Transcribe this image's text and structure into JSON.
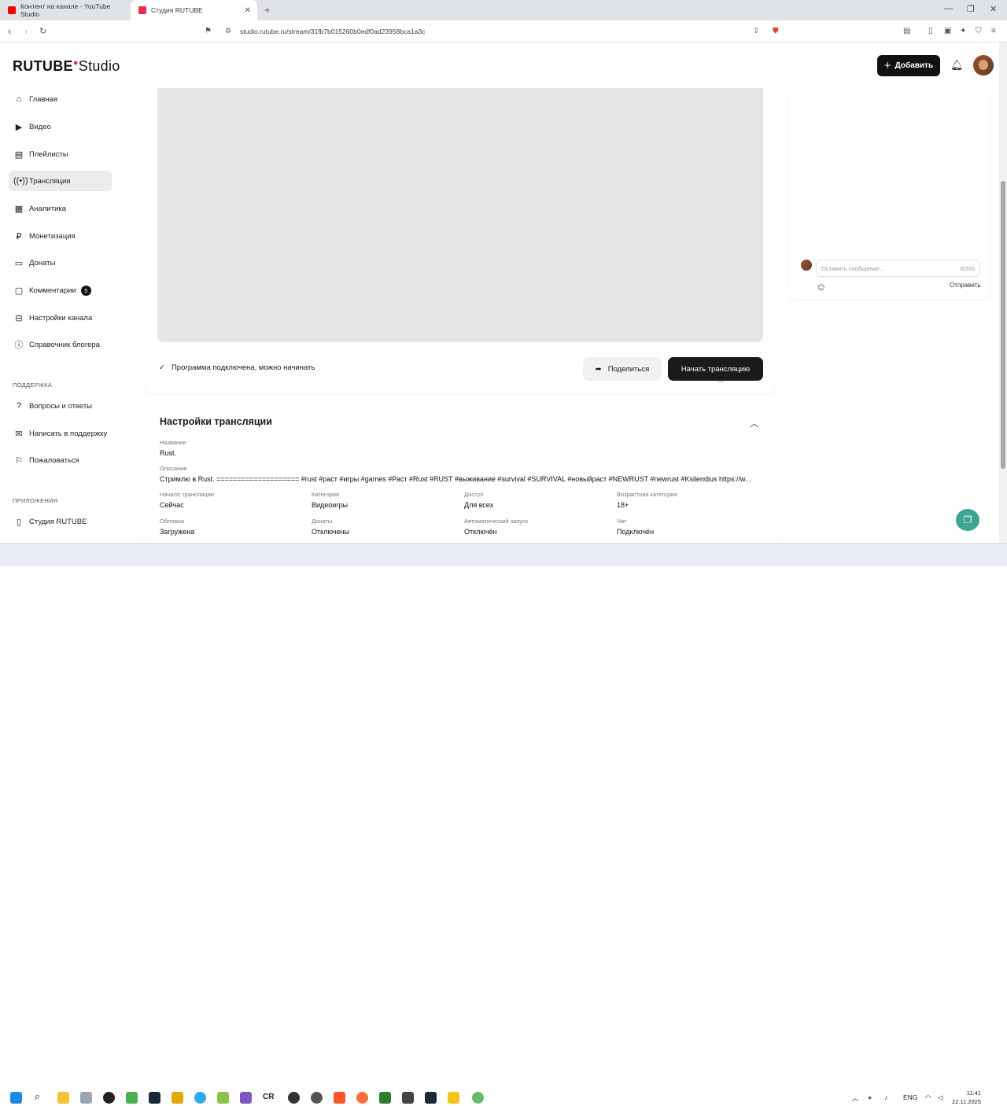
{
  "browser": {
    "tabs": [
      {
        "label": "Контент на канале - YouTube Studio",
        "color": "#ff0000"
      },
      {
        "label": "Студия RUTUBE",
        "color": "#e8304a"
      }
    ],
    "url": "studio.rutube.ru/stream/31fb7b015260b0edf0ad23958bca1a3c"
  },
  "header": {
    "logo_brand": "RUTUBE",
    "logo_product": "Studio",
    "add_label": "Добавить"
  },
  "sidebar": {
    "items": [
      {
        "label": "Главная",
        "icon": "home-icon"
      },
      {
        "label": "Видео",
        "icon": "video-icon"
      },
      {
        "label": "Плейлисты",
        "icon": "playlist-icon"
      },
      {
        "label": "Трансляции",
        "icon": "broadcast-icon"
      },
      {
        "label": "Аналитика",
        "icon": "analytics-icon"
      },
      {
        "label": "Монетизация",
        "icon": "money-icon"
      },
      {
        "label": "Донаты",
        "icon": "donate-icon"
      },
      {
        "label": "Комментарии",
        "icon": "comment-icon",
        "badge": "5"
      },
      {
        "label": "Настройки канала",
        "icon": "settings-icon"
      },
      {
        "label": "Справочник блогера",
        "icon": "info-icon"
      }
    ],
    "support_heading": "ПОДДЕРЖКА",
    "support_items": [
      {
        "label": "Вопросы и ответы"
      },
      {
        "label": "Написать в поддержку"
      },
      {
        "label": "Пожаловаться"
      }
    ],
    "apps_heading": "ПРИЛОЖЕНИЯ",
    "apps_items": [
      {
        "label": "Студия RUTUBE"
      }
    ]
  },
  "stream": {
    "status": "Программа подключена, можно начинать",
    "share_label": "Поделиться",
    "start_label": "Начать трансляцию"
  },
  "settings": {
    "title": "Настройки трансляции",
    "name_label": "Название",
    "name_value": "Rust.",
    "desc_label": "Описание",
    "desc_value": "Стримлю в Rust. ==================== #rust #раст #игры #games #Раст #Rust #RUST #выживание #survival #SURVIVAL #новыйраст #NEWRUST #newrust #Ksilendius https://w...",
    "grid": [
      {
        "label": "Начало трансляции",
        "value": "Сейчас"
      },
      {
        "label": "Категория",
        "value": "Видеоигры"
      },
      {
        "label": "Доступ",
        "value": "Для всех"
      },
      {
        "label": "Возрастная категория",
        "value": "18+"
      },
      {
        "label": "Обложка",
        "value": "Загружена"
      },
      {
        "label": "Донаты",
        "value": "Отключены"
      },
      {
        "label": "Автоматический запуск",
        "value": "Отключён"
      },
      {
        "label": "Чат",
        "value": "Подключён"
      }
    ]
  },
  "chat": {
    "placeholder": "Оставить сообщение...",
    "counter": "0/200",
    "send_label": "Отправить"
  },
  "taskbar": {
    "lang": "ENG",
    "time": "11:41",
    "date": "22.11.2025"
  }
}
